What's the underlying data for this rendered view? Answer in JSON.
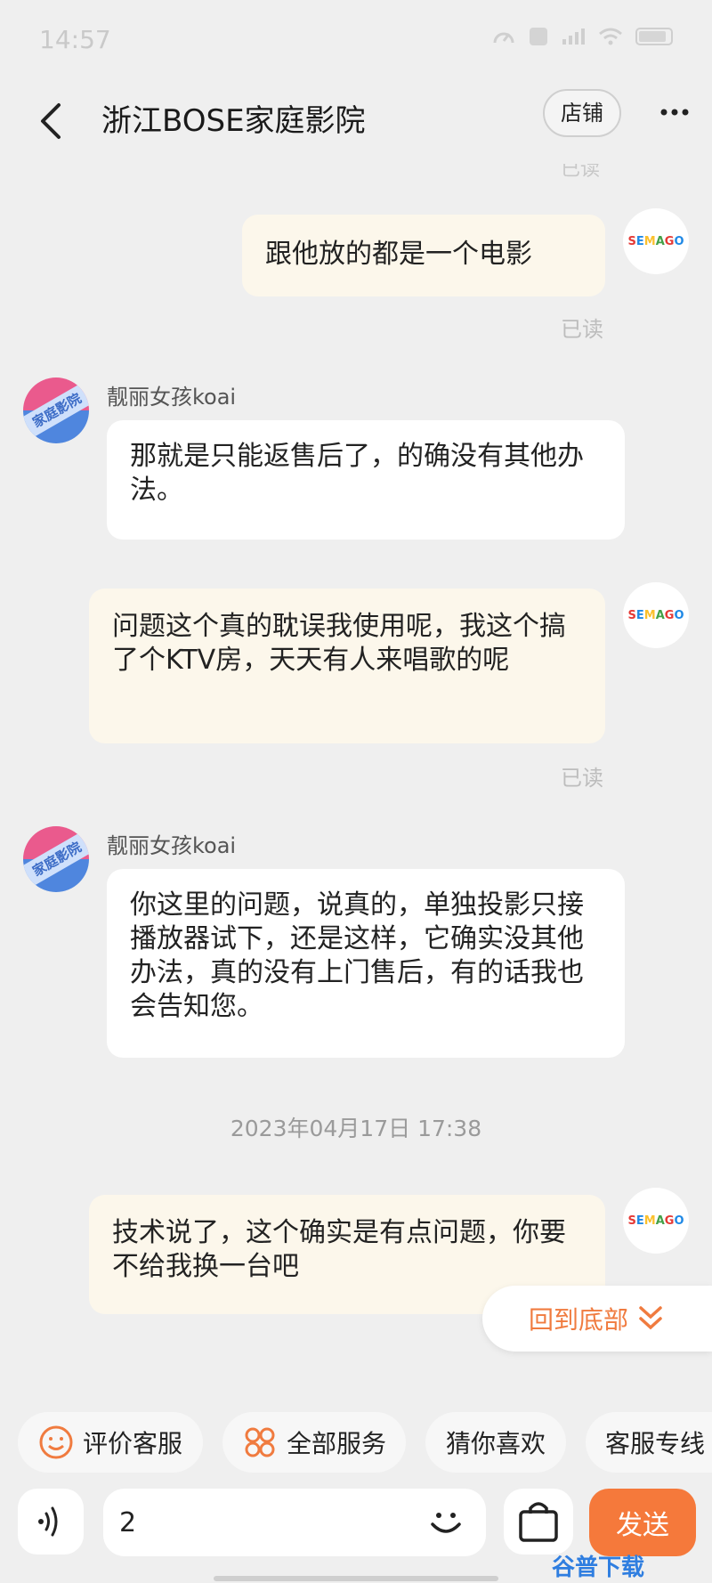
{
  "status_bar": {
    "time": "14:57"
  },
  "header": {
    "title": "浙江BOSE家庭影院",
    "shop_label": "店铺"
  },
  "messages": [
    {
      "side": "mine",
      "text": "跟他放的都是一个电影",
      "read": "已读"
    },
    {
      "side": "theirs",
      "sender": "靓丽女孩koai",
      "text": "那就是只能返售后了，的确没有其他办法。"
    },
    {
      "side": "mine",
      "text": "问题这个真的耽误我使用呢，我这个搞了个KTV房，天天有人来唱歌的呢",
      "read": "已读"
    },
    {
      "side": "theirs",
      "sender": "靓丽女孩koai",
      "text": "你这里的问题，说真的，单独投影只接播放器试下，还是这样，它确实没其他办法，真的没有上门售后，有的话我也会告知您。"
    },
    {
      "side": "mine",
      "text": "技术说了，这个确实是有点问题，你要不给我换一台吧"
    }
  ],
  "top_read_label": "已读",
  "timestamp": "2023年04月17日 17:38",
  "back_to_bottom_label": "回到底部",
  "quick_actions": [
    {
      "label": "评价客服",
      "icon": "smile-icon"
    },
    {
      "label": "全部服务",
      "icon": "grid-icon"
    },
    {
      "label": "猜你喜欢",
      "icon": ""
    },
    {
      "label": "客服专线",
      "icon": ""
    }
  ],
  "input": {
    "value": "2"
  },
  "send_label": "发送",
  "watermark": "谷普下载",
  "colors": {
    "accent": "#f5793b",
    "my_bubble": "#fcf7eb",
    "their_bubble": "#ffffff",
    "background": "#efefef"
  }
}
